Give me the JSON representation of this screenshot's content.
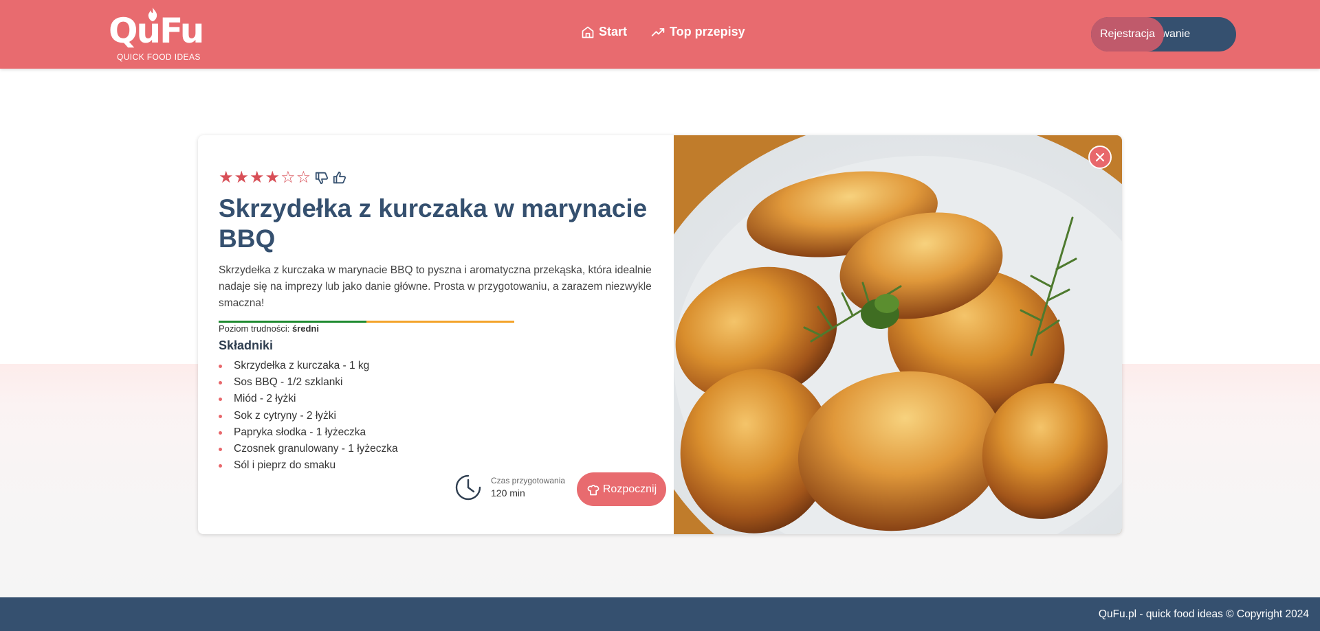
{
  "header": {
    "logo_text": "QuFu",
    "logo_tagline": "QUICK FOOD IDEAS",
    "nav": [
      {
        "label": "Start",
        "icon": "home-icon"
      },
      {
        "label": "Top przepisy",
        "icon": "trending-up-icon"
      }
    ],
    "auth": {
      "register_label": "Rejestracja",
      "login_label": "Logowanie"
    }
  },
  "recipe": {
    "rating": {
      "value": 4,
      "max": 6
    },
    "title": "Skrzydełka z kurczaka w marynacie BBQ",
    "description": "Skrzydełka z kurczaka w marynacie BBQ to pyszna i aromatyczna przekąska, która idealnie nadaje się na imprezy lub jako danie główne. Prosta w przygotowaniu, a zarazem niezwykle smaczna!",
    "difficulty": {
      "label": "Poziom trudności:",
      "value": "średni",
      "level": 0.5
    },
    "ingredients_heading": "Składniki",
    "ingredients": [
      "Skrzydełka z kurczaka - 1 kg",
      "Sos BBQ - 1/2 szklanki",
      "Miód - 2 łyżki",
      "Sok z cytryny - 2 łyżki",
      "Papryka słodka - 1 łyżeczka",
      "Czosnek granulowany - 1 łyżeczka",
      "Sól i pieprz do smaku"
    ],
    "prep_time": {
      "label": "Czas przygotowania",
      "value": "120 min"
    },
    "start_label": "Rozpocznij"
  },
  "footer": {
    "text": "QuFu.pl - quick food ideas © Copyright 2024"
  },
  "colors": {
    "accent": "#e86b6f",
    "navy": "#35506f",
    "star": "#d84f57"
  }
}
